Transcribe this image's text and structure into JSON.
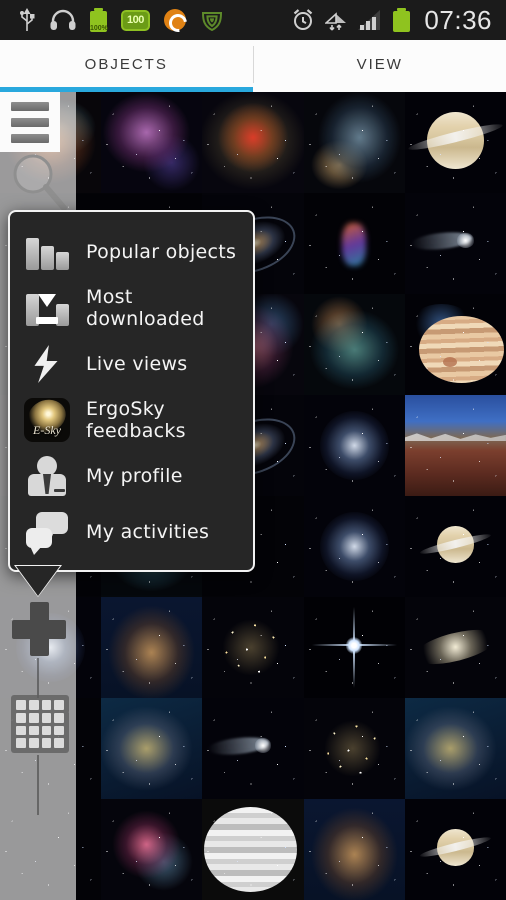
{
  "statusbar": {
    "time": "07:36",
    "battery_percent_label": "100%",
    "badge_label": "100",
    "left_icons": [
      "usb-icon",
      "headphones-icon",
      "battery-charge-icon",
      "battery-100-badge-icon",
      "sync-icon",
      "wifi-shield-icon"
    ],
    "right_icons": [
      "alarm-clock-icon",
      "wifi-data-icon",
      "signal-bars-icon",
      "battery-icon"
    ],
    "background": "#1b1b1b"
  },
  "tabs": {
    "accent_color": "#29a8dd",
    "items": [
      {
        "label": "OBJECTS",
        "active": true
      },
      {
        "label": "VIEW",
        "active": false
      }
    ]
  },
  "toolbar": {
    "menu_button": "hamburger-menu",
    "search_button": "search",
    "add_button": "add",
    "grid_button": "grid-view"
  },
  "popup_menu": {
    "background": "#262626",
    "border_color": "#f2f2f2",
    "items": [
      {
        "label": "Popular objects",
        "icon": "bar-chart-icon"
      },
      {
        "label": "Most downloaded",
        "icon": "download-icon"
      },
      {
        "label": "Live views",
        "icon": "lightning-bolt-icon"
      },
      {
        "label": "ErgoSky feedbacks",
        "icon": "ergosky-galaxy-icon",
        "icon_text": "E-Sky"
      },
      {
        "label": "My profile",
        "icon": "user-profile-icon"
      },
      {
        "label": "My activities",
        "icon": "chat-bubbles-icon"
      }
    ]
  },
  "gallery": {
    "columns": 5,
    "rows": 8,
    "tiles": [
      {
        "name": "nebula-reddish",
        "style": "nebula-d"
      },
      {
        "name": "nebula-purple",
        "style": "nebula-a"
      },
      {
        "name": "supernova-remnant",
        "style": "nebula-b"
      },
      {
        "name": "nebula-bluegold",
        "style": "nebula-c"
      },
      {
        "name": "saturn",
        "style": "planet-saturn"
      },
      {
        "name": "deep-sky-field",
        "style": "dark"
      },
      {
        "name": "dark-field",
        "style": "dark"
      },
      {
        "name": "spiral-galaxy",
        "style": "galaxy-spiral"
      },
      {
        "name": "quasar-jet",
        "style": "jet"
      },
      {
        "name": "comet",
        "style": "comet"
      },
      {
        "name": "star-field",
        "style": "dark"
      },
      {
        "name": "star-field-2",
        "style": "dark"
      },
      {
        "name": "red-nebula",
        "style": "nebula-e"
      },
      {
        "name": "blue-nebula",
        "style": "nebula-f"
      },
      {
        "name": "jupiter",
        "style": "planet-jup"
      },
      {
        "name": "dusty-nebula",
        "style": "nebula-d"
      },
      {
        "name": "nebula-wide",
        "style": "nebula-c"
      },
      {
        "name": "barred-galaxy",
        "style": "galaxy-spiral"
      },
      {
        "name": "glowing-core",
        "style": "galaxy-face"
      },
      {
        "name": "mars-terrain",
        "style": "mars-surface"
      },
      {
        "name": "dark-nebula",
        "style": "dark"
      },
      {
        "name": "nebula-teal",
        "style": "nebula-f"
      },
      {
        "name": "dark-field-3",
        "style": "dark"
      },
      {
        "name": "face-on-galaxy",
        "style": "galaxy-face"
      },
      {
        "name": "saturn-small",
        "style": "planet-saturn small"
      },
      {
        "name": "galaxy-pale",
        "style": "galaxy-face"
      },
      {
        "name": "pillars-of-creation",
        "style": "pillars"
      },
      {
        "name": "globular-cluster",
        "style": "cluster"
      },
      {
        "name": "bright-star",
        "style": "star-bright"
      },
      {
        "name": "edge-on-galaxy",
        "style": "galaxy-edge"
      },
      {
        "name": "milky-way-band",
        "style": "dark"
      },
      {
        "name": "emission-nebula",
        "style": "carina"
      },
      {
        "name": "comet-2",
        "style": "comet"
      },
      {
        "name": "open-cluster",
        "style": "cluster"
      },
      {
        "name": "carina-nebula",
        "style": "carina"
      },
      {
        "name": "aurora-field",
        "style": "dark"
      },
      {
        "name": "orion-nebula",
        "style": "orion"
      },
      {
        "name": "jupiter-mono",
        "style": "planet-grey"
      },
      {
        "name": "nebula-blue-deep",
        "style": "pillars"
      },
      {
        "name": "saturn-tilted",
        "style": "planet-saturn small"
      }
    ]
  }
}
